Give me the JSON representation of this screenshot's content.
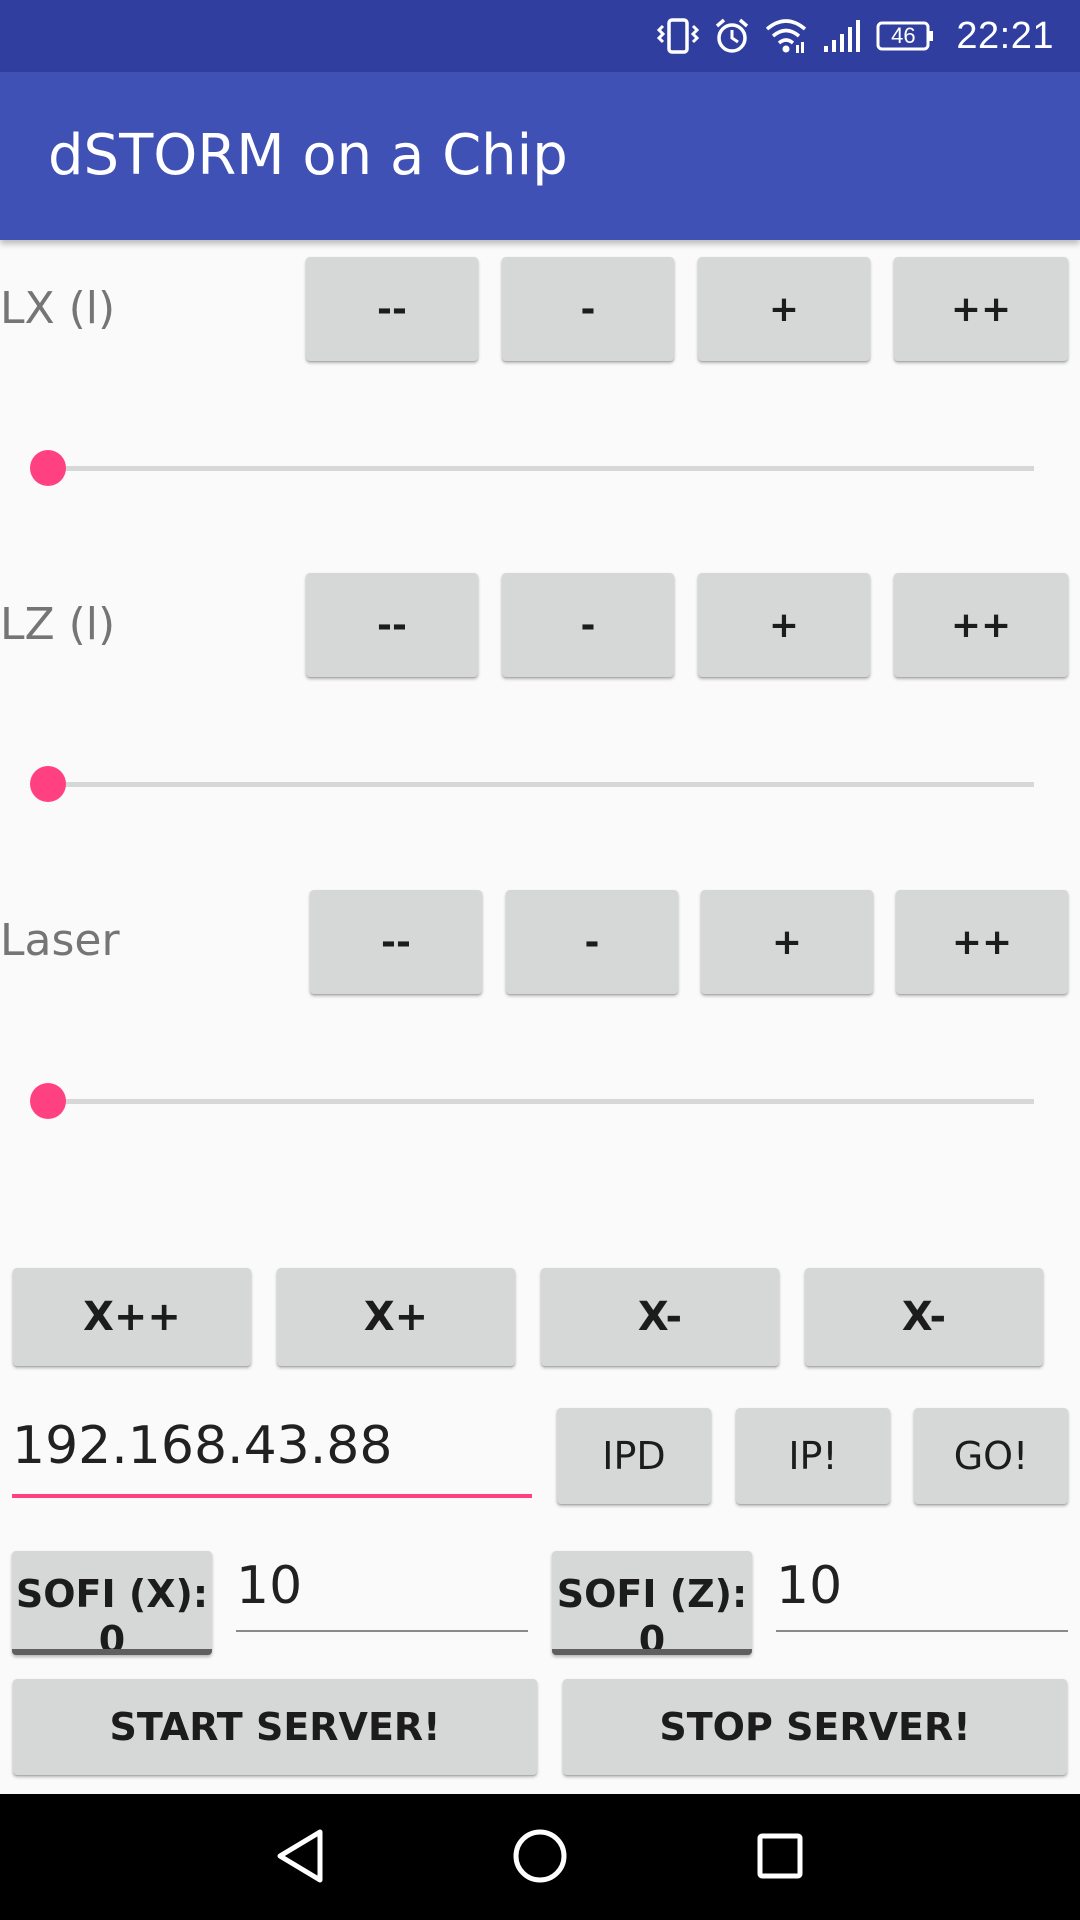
{
  "status_bar": {
    "time": "22:21",
    "battery": "46",
    "icons": [
      "vibrate-icon",
      "alarm-icon",
      "wifi-icon",
      "signal-icon",
      "battery-icon"
    ]
  },
  "app_bar": {
    "title": "dSTORM on a Chip",
    "color": "#3f51b5"
  },
  "controls": [
    {
      "label": "LX (l)",
      "buttons": [
        "--",
        "-",
        "+",
        "++"
      ],
      "slider_value": 0
    },
    {
      "label": "LZ (l)",
      "buttons": [
        "--",
        "-",
        "+",
        "++"
      ],
      "slider_value": 0
    },
    {
      "label": "Laser",
      "buttons": [
        "--",
        "-",
        "+",
        "++"
      ],
      "slider_value": 0
    }
  ],
  "x_buttons": [
    "X++",
    "X+",
    "X-",
    "X-"
  ],
  "ip": {
    "value": "192.168.43.88",
    "buttons": [
      "IPD",
      "IP!",
      "GO!"
    ]
  },
  "sofi": [
    {
      "label": "SOFI (X): 0",
      "value": "10"
    },
    {
      "label": "SOFI (Z): 0",
      "value": "10"
    }
  ],
  "server": {
    "start_label": "START SERVER!",
    "stop_label": "STOP SERVER!"
  },
  "accent_color": "#ff4081",
  "nav_bar": {
    "icons": [
      "back-icon",
      "home-icon",
      "recents-icon"
    ]
  }
}
